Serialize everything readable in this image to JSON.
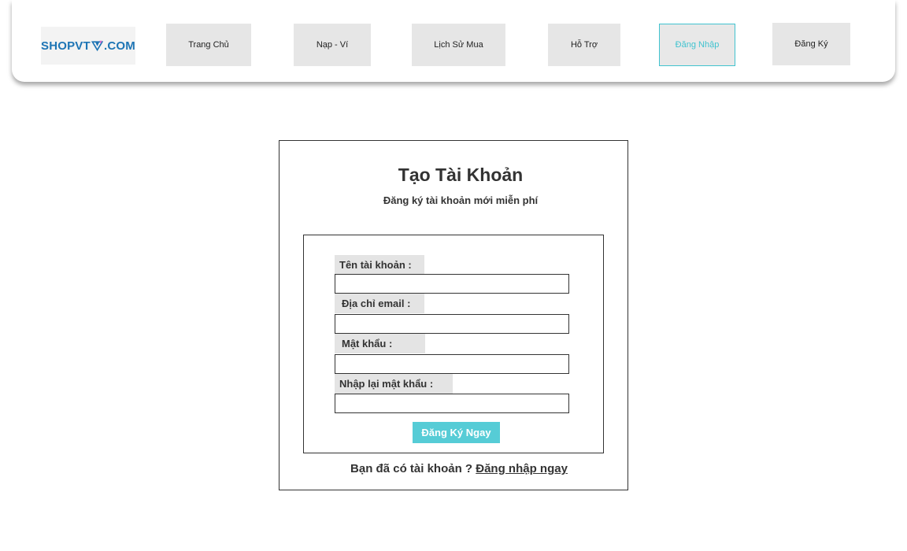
{
  "nav": {
    "logo": {
      "prefix": "SHOPVT",
      "suffix": ".COM",
      "icon": "diamond-logo-icon"
    },
    "items": [
      {
        "label": "Trang Chủ"
      },
      {
        "label": "Nạp - Ví"
      },
      {
        "label": "Lịch Sử Mua"
      },
      {
        "label": "Hỗ Trợ"
      },
      {
        "label": "Đăng Nhập",
        "active": true
      },
      {
        "label": "Đăng Ký"
      }
    ],
    "accent_color": "#41c3cf"
  },
  "register": {
    "title": "Tạo Tài Khoản",
    "subtitle": "Đăng ký tài khoản mới miễn phí",
    "fields": [
      {
        "label": "Tên tài khoản :",
        "value": ""
      },
      {
        "label": "Địa chỉ email :",
        "value": ""
      },
      {
        "label": "Mật khẩu  :",
        "value": ""
      },
      {
        "label": "Nhập lại mật khẩu  :",
        "value": ""
      }
    ],
    "submit_label": "Đăng Ký Ngay",
    "submit_color": "#56ccd6",
    "footer_text": "Bạn đã có tài khoản ? ",
    "footer_link": "Đăng nhập ngay"
  }
}
